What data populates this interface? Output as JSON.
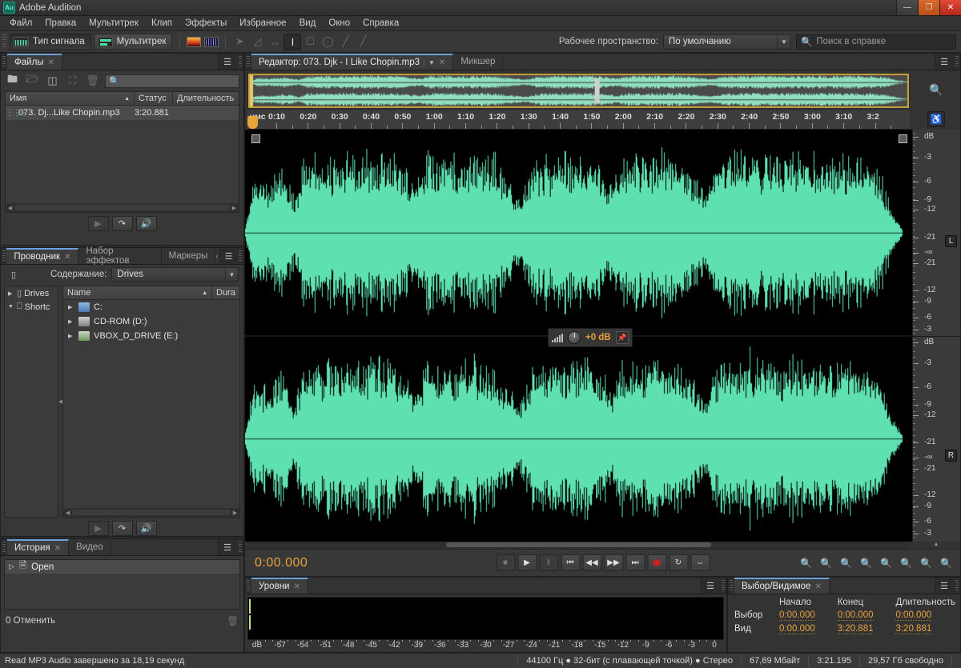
{
  "window": {
    "app_icon": "Au",
    "title": "Adobe Audition",
    "minimize": "—",
    "maximize": "❐",
    "close": "✕"
  },
  "menubar": [
    {
      "label": "Файл"
    },
    {
      "label": "Правка"
    },
    {
      "label": "Мультитрек"
    },
    {
      "label": "Клип"
    },
    {
      "label": "Эффекты"
    },
    {
      "label": "Избранное"
    },
    {
      "label": "Вид"
    },
    {
      "label": "Окно"
    },
    {
      "label": "Справка"
    }
  ],
  "toolbar": {
    "waveform_button": "Тип сигнала",
    "multitrack_button": "Мультитрек",
    "workspace_label": "Рабочее пространство:",
    "workspace_value": "По умолчанию",
    "help_search_placeholder": "Поиск в справке"
  },
  "files_panel": {
    "tab": "Файлы",
    "search_placeholder": "",
    "columns": [
      "Имя",
      "Статус",
      "Длительность"
    ],
    "rows": [
      {
        "name": "073. Dj...Like Chopin.mp3",
        "status": "",
        "duration": "3:20.881"
      }
    ]
  },
  "explorer_panel": {
    "tabs": [
      "Проводник",
      "Набор эффектов",
      "Маркеры"
    ],
    "active_tab": "Проводник",
    "content_label": "Содержание:",
    "content_value": "Drives",
    "tree": [
      {
        "label": "Drives"
      },
      {
        "label": "Shortc"
      }
    ],
    "columns": [
      "Name",
      "Dura"
    ],
    "rows": [
      {
        "name": "C:",
        "color": "#7fa8d8"
      },
      {
        "name": "CD-ROM (D:)",
        "color": "#b9b9b9"
      },
      {
        "name": "VBOX_D_DRIVE (E:)",
        "color": "#9ec98a"
      }
    ]
  },
  "history_panel": {
    "tabs": [
      "История",
      "Видео"
    ],
    "active_tab": "История",
    "rows": [
      {
        "label": "Open"
      }
    ],
    "undo_label": "0 Отменить"
  },
  "editor": {
    "tabs": [
      "Редактор: 073. Djk - I Like Chopin.mp3",
      "Микшер"
    ],
    "active_tab": "Редактор: 073. Djk - I Like Chopin.mp3",
    "ruler_unit": "чмс",
    "ruler_ticks": [
      "0:10",
      "0:20",
      "0:30",
      "0:40",
      "0:50",
      "1:00",
      "1:10",
      "1:20",
      "1:30",
      "1:40",
      "1:50",
      "2:00",
      "2:10",
      "2:20",
      "2:30",
      "2:40",
      "2:50",
      "3:00",
      "3:10",
      "3:2"
    ],
    "db_scale_left": [
      "dB",
      "-3",
      "-6",
      "-9",
      "-12",
      "-21",
      "-∞",
      "-21",
      "-12",
      "-9",
      "-6",
      "-3"
    ],
    "db_scale_right": [
      "dB",
      "-3",
      "-6",
      "-9",
      "-12",
      "-21",
      "-∞",
      "-21",
      "-12",
      "-9",
      "-6",
      "-3"
    ],
    "channel_left": "L",
    "channel_right": "R",
    "hud_value": "+0 dB",
    "waveform_color": "#5fe0b0"
  },
  "transport": {
    "time": "0:00.000",
    "buttons": [
      {
        "name": "stop",
        "glyph": "■"
      },
      {
        "name": "play",
        "glyph": "▶"
      },
      {
        "name": "pause",
        "glyph": "‖"
      },
      {
        "name": "move-to-start",
        "glyph": "⏮"
      },
      {
        "name": "rewind",
        "glyph": "◀◀"
      },
      {
        "name": "fast-forward",
        "glyph": "▶▶"
      },
      {
        "name": "move-to-end",
        "glyph": "⏭"
      },
      {
        "name": "record",
        "glyph": ""
      },
      {
        "name": "loop",
        "glyph": "↻"
      },
      {
        "name": "skip-selection",
        "glyph": "⇔"
      }
    ]
  },
  "levels_panel": {
    "tab": "Уровни",
    "scale": [
      "dB",
      "-57",
      "-54",
      "-51",
      "-48",
      "-45",
      "-42",
      "-39",
      "-36",
      "-33",
      "-30",
      "-27",
      "-24",
      "-21",
      "-18",
      "-15",
      "-12",
      "-9",
      "-6",
      "-3",
      "0"
    ]
  },
  "selection_panel": {
    "tab": "Выбор/Видимое",
    "columns": [
      "Начало",
      "Конец",
      "Длительность"
    ],
    "rows": [
      {
        "label": "Выбор",
        "start": "0:00.000",
        "end": "0:00.000",
        "duration": "0:00.000"
      },
      {
        "label": "Вид",
        "start": "0:00.000",
        "end": "3:20.881",
        "duration": "3:20.881"
      }
    ]
  },
  "statusbar": {
    "message": "Read MP3 Audio завершено за 18,19 секунд",
    "sample_rate": "44100 Гц ● 32-бит (с плавающей точкой) ● Стерео",
    "file_size": "67,69 Мбайт",
    "duration": "3:21.195",
    "free_space": "29,57 Гб свободно"
  }
}
